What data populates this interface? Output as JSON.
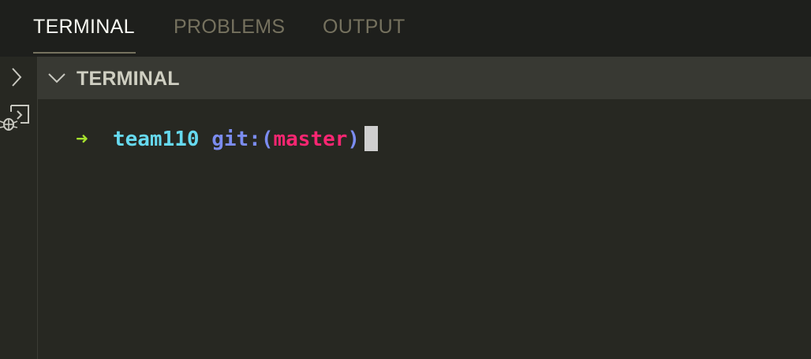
{
  "tabs": [
    {
      "label": "TERMINAL",
      "active": true
    },
    {
      "label": "PROBLEMS",
      "active": false
    },
    {
      "label": "OUTPUT",
      "active": false
    }
  ],
  "sidebar": {
    "icons": [
      "chevron-right-icon",
      "debug-console-icon"
    ]
  },
  "section": {
    "title": "TERMINAL",
    "icon": "chevron-down-icon"
  },
  "terminal": {
    "prompt_arrow": "➜",
    "directory": "team110",
    "git_prefix": "git:(",
    "branch": "master",
    "git_suffix": ")"
  },
  "colors": {
    "background": "#272822",
    "arrow": "#a6e22e",
    "directory": "#66d9ef",
    "git": "#7b8cf0",
    "branch": "#f92672"
  }
}
